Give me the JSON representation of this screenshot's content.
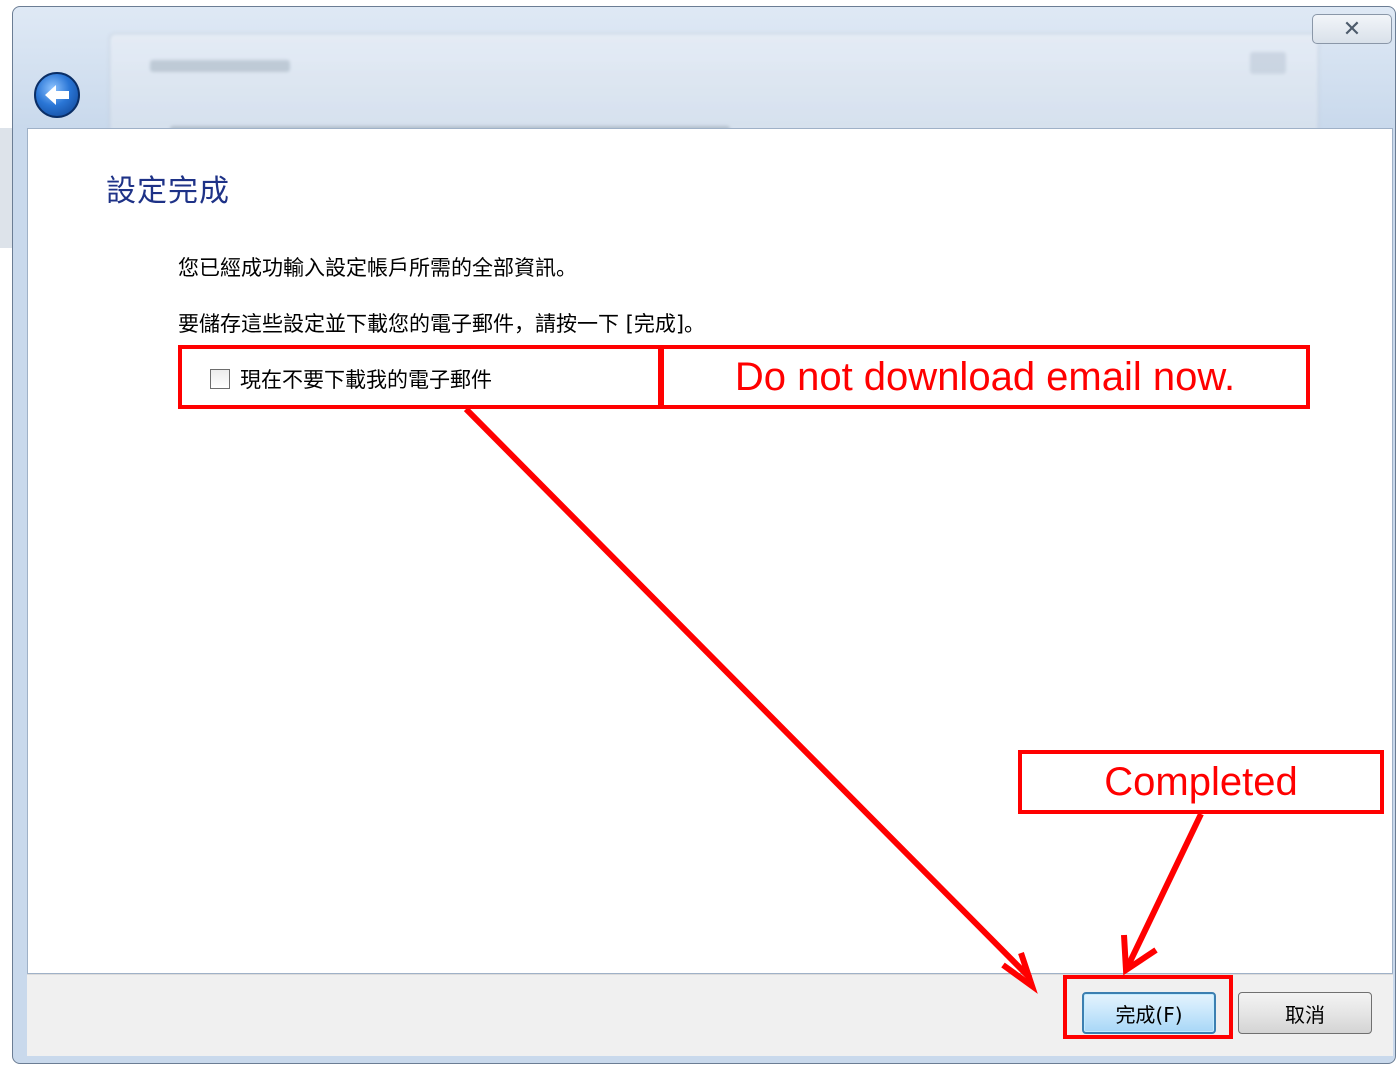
{
  "window": {
    "close_glyph": "✕"
  },
  "page": {
    "title": "設定完成",
    "line1": "您已經成功輸入設定帳戶所需的全部資訊。",
    "line2": "要儲存這些設定並下載您的電子郵件，請按一下 [完成]。",
    "checkbox_label": "現在不要下載我的電子郵件",
    "checkbox_checked": false
  },
  "annotations": {
    "note_checkbox": "Do not download email now.",
    "note_finish": "Completed",
    "color": "#ff0000"
  },
  "footer": {
    "finish_label": "完成(F)",
    "cancel_label": "取消"
  },
  "icons": {
    "back": "back-arrow-icon",
    "close": "close-icon"
  }
}
